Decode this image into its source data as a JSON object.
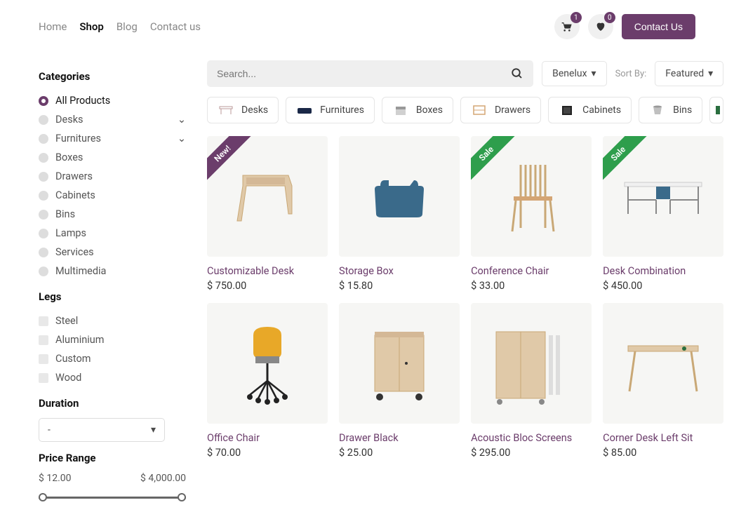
{
  "nav": {
    "items": [
      "Home",
      "Shop",
      "Blog",
      "Contact us"
    ],
    "active": "Shop"
  },
  "header": {
    "cart_count": "1",
    "wishlist_count": "0",
    "contact_btn": "Contact Us"
  },
  "sidebar": {
    "categories_title": "Categories",
    "categories": [
      {
        "label": "All Products",
        "active": true,
        "expandable": false
      },
      {
        "label": "Desks",
        "active": false,
        "expandable": true
      },
      {
        "label": "Furnitures",
        "active": false,
        "expandable": true
      },
      {
        "label": "Boxes",
        "active": false,
        "expandable": false
      },
      {
        "label": "Drawers",
        "active": false,
        "expandable": false
      },
      {
        "label": "Cabinets",
        "active": false,
        "expandable": false
      },
      {
        "label": "Bins",
        "active": false,
        "expandable": false
      },
      {
        "label": "Lamps",
        "active": false,
        "expandable": false
      },
      {
        "label": "Services",
        "active": false,
        "expandable": false
      },
      {
        "label": "Multimedia",
        "active": false,
        "expandable": false
      }
    ],
    "legs_title": "Legs",
    "legs": [
      "Steel",
      "Aluminium",
      "Custom",
      "Wood"
    ],
    "duration_title": "Duration",
    "duration_value": "-",
    "price_title": "Price Range",
    "price_min": "$ 12.00",
    "price_max": "$ 4,000.00"
  },
  "toolbar": {
    "search_placeholder": "Search...",
    "region": "Benelux",
    "sort_label": "Sort By:",
    "sort_value": "Featured"
  },
  "chips": [
    "Desks",
    "Furnitures",
    "Boxes",
    "Drawers",
    "Cabinets",
    "Bins"
  ],
  "products": [
    {
      "name": "Customizable Desk",
      "price": "$ 750.00",
      "ribbon": "New!",
      "ribbon_type": "new"
    },
    {
      "name": "Storage Box",
      "price": "$ 15.80",
      "ribbon": "",
      "ribbon_type": ""
    },
    {
      "name": "Conference Chair",
      "price": "$ 33.00",
      "ribbon": "Sale",
      "ribbon_type": "sale"
    },
    {
      "name": "Desk Combination",
      "price": "$ 450.00",
      "ribbon": "Sale",
      "ribbon_type": "sale"
    },
    {
      "name": "Office Chair",
      "price": "$ 70.00",
      "ribbon": "",
      "ribbon_type": ""
    },
    {
      "name": "Drawer Black",
      "price": "$ 25.00",
      "ribbon": "",
      "ribbon_type": ""
    },
    {
      "name": "Acoustic Bloc Screens",
      "price": "$ 295.00",
      "ribbon": "",
      "ribbon_type": ""
    },
    {
      "name": "Corner Desk Left Sit",
      "price": "$ 85.00",
      "ribbon": "",
      "ribbon_type": ""
    }
  ]
}
